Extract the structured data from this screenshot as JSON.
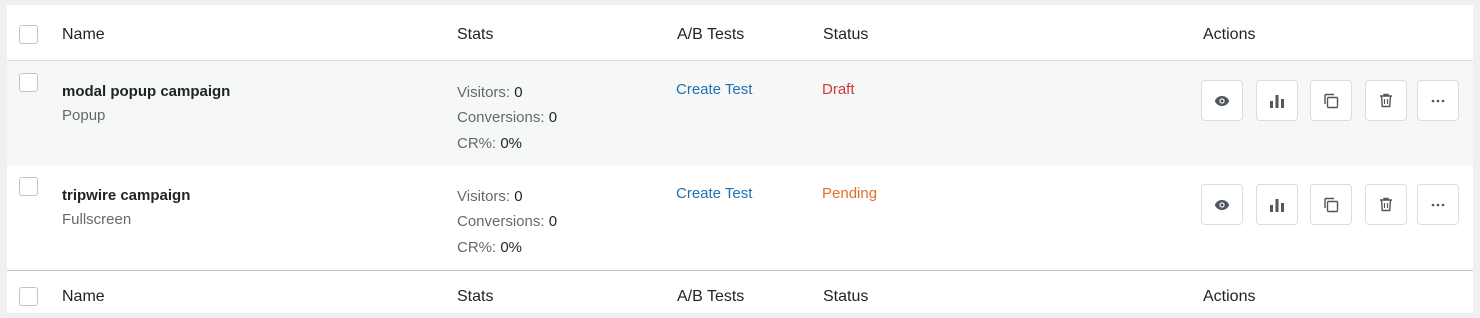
{
  "header": {
    "name": "Name",
    "stats": "Stats",
    "ab_tests": "A/B Tests",
    "status": "Status",
    "actions": "Actions"
  },
  "footer": {
    "name": "Name",
    "stats": "Stats",
    "ab_tests": "A/B Tests",
    "status": "Status",
    "actions": "Actions"
  },
  "labels": {
    "visitors": "Visitors:",
    "conversions": "Conversions:",
    "cr": "CR%:"
  },
  "rows": [
    {
      "name": "modal popup campaign",
      "type": "Popup",
      "visitors": "0",
      "conversions": "0",
      "cr": "0%",
      "ab_test_link": "Create Test",
      "status": "Draft",
      "status_color": "#d63638"
    },
    {
      "name": "tripwire campaign",
      "type": "Fullscreen",
      "visitors": "0",
      "conversions": "0",
      "cr": "0%",
      "ab_test_link": "Create Test",
      "status": "Pending",
      "status_color": "#e26f2a"
    }
  ],
  "action_icons": [
    "eye-icon",
    "bar-chart-icon",
    "duplicate-icon",
    "trash-icon",
    "more-icon"
  ],
  "colors": {
    "link": "#2271b1",
    "muted": "#646970",
    "row_alt_bg": "#f6f7f7"
  }
}
